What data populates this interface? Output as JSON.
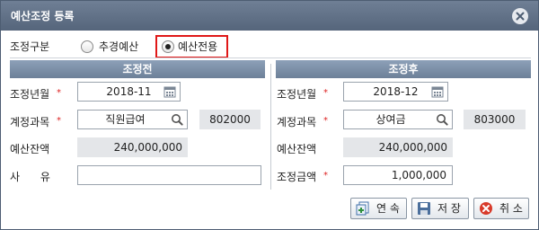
{
  "window": {
    "title": "예산조정 등록"
  },
  "type_group": {
    "label": "조정구분",
    "options": [
      {
        "label": "추경예산",
        "selected": false
      },
      {
        "label": "예산전용",
        "selected": true
      }
    ]
  },
  "left": {
    "header": "조정전",
    "period_label": "조정년월",
    "period_value": "2018-11",
    "account_label": "계정과목",
    "account_name": "직원급여",
    "account_code": "802000",
    "balance_label": "예산잔액",
    "balance_value": "240,000,000",
    "reason_label": "사      유",
    "reason_value": ""
  },
  "right": {
    "header": "조정후",
    "period_label": "조정년월",
    "period_value": "2018-12",
    "account_label": "계정과목",
    "account_name": "상여금",
    "account_code": "803000",
    "balance_label": "예산잔액",
    "balance_value": "240,000,000",
    "amount_label": "조정금액",
    "amount_value": "1,000,000"
  },
  "required_mark": "*",
  "buttons": {
    "continue": "연 속",
    "save": "저 장",
    "cancel": "취 소"
  }
}
